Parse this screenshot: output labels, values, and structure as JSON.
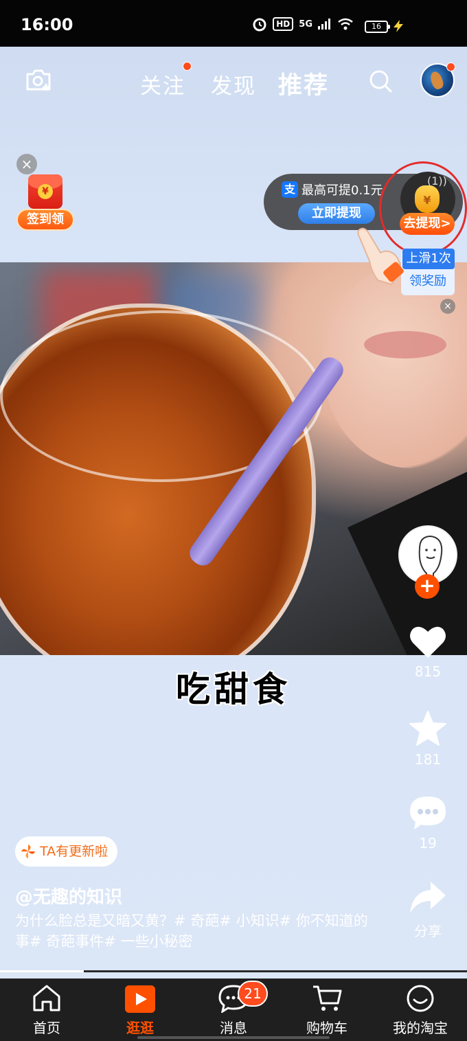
{
  "status_bar": {
    "time": "16:00",
    "network": "5G",
    "hd": "HD",
    "battery": "16"
  },
  "top_nav": {
    "tabs": [
      {
        "label": "关注"
      },
      {
        "label": "发现"
      },
      {
        "label": "推荐"
      }
    ]
  },
  "checkin": {
    "close": "×",
    "coin": "¥",
    "label": "签到领"
  },
  "withdraw": {
    "alipay": "支",
    "text": "最高可提0.1元",
    "button": "立即提现",
    "sound": "(1))",
    "go_label": "去提现>",
    "coin": "¥"
  },
  "swipe_hint": {
    "line1": "上滑1次",
    "line2": "领奖励",
    "close": "×"
  },
  "caption": "吃甜食",
  "actions": {
    "likes": "815",
    "favorites": "181",
    "comments": "19",
    "share": "分享",
    "follow_plus": "+"
  },
  "update_badge": "TA有更新啦",
  "author": "@无趣的知识",
  "description": "为什么脸总是又暗又黄？# 奇葩# 小知识# 你不知道的事# 奇葩事件# 一些小秘密",
  "progress": 0.18,
  "bottom_nav": {
    "tabs": [
      {
        "label": "首页"
      },
      {
        "label": "逛逛"
      },
      {
        "label": "消息"
      },
      {
        "label": "购物车"
      },
      {
        "label": "我的淘宝"
      }
    ],
    "message_badge": "21"
  },
  "colors": {
    "accent": "#ff5000",
    "annotation": "#e32b2b",
    "alipay": "#1677ff"
  }
}
